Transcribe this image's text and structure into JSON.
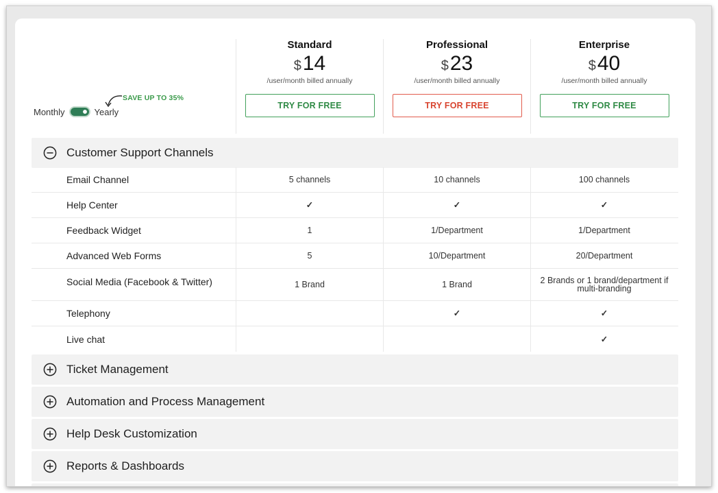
{
  "toggle": {
    "left_label": "Monthly",
    "right_label": "Yearly",
    "note": "SAVE UP TO 35%"
  },
  "plans": [
    {
      "name": "Standard",
      "currency": "$",
      "price": "14",
      "billing": "/user/month billed annually",
      "cta": "TRY FOR FREE",
      "cta_color": "#2f8a45"
    },
    {
      "name": "Professional",
      "currency": "$",
      "price": "23",
      "billing": "/user/month billed annually",
      "cta": "TRY FOR FREE",
      "cta_color": "#d8442f"
    },
    {
      "name": "Enterprise",
      "currency": "$",
      "price": "40",
      "billing": "/user/month billed annually",
      "cta": "TRY FOR FREE",
      "cta_color": "#2f8a45"
    }
  ],
  "sections": [
    {
      "title": "Customer Support Channels",
      "expanded": true,
      "icon": "minus-circle-icon"
    },
    {
      "title": "Ticket Management",
      "expanded": false,
      "icon": "plus-circle-icon"
    },
    {
      "title": "Automation and Process Management",
      "expanded": false,
      "icon": "plus-circle-icon"
    },
    {
      "title": "Help Desk Customization",
      "expanded": false,
      "icon": "plus-circle-icon"
    },
    {
      "title": "Reports & Dashboards",
      "expanded": false,
      "icon": "plus-circle-icon"
    }
  ],
  "features": [
    {
      "name": "Email Channel",
      "values": [
        "5 channels",
        "10 channels",
        "100 channels"
      ]
    },
    {
      "name": "Help Center",
      "values": [
        "✓",
        "✓",
        "✓"
      ]
    },
    {
      "name": "Feedback Widget",
      "values": [
        "1",
        "1/Department",
        "1/Department"
      ]
    },
    {
      "name": "Advanced Web Forms",
      "values": [
        "5",
        "10/Department",
        "20/Department"
      ]
    },
    {
      "name": "Social Media (Facebook & Twitter)",
      "values": [
        "1 Brand",
        "1 Brand",
        "2 Brands or 1 brand/department if multi-branding"
      ]
    },
    {
      "name": "Telephony",
      "values": [
        "",
        "✓",
        "✓"
      ]
    },
    {
      "name": "Live chat",
      "values": [
        "",
        "",
        "✓"
      ]
    }
  ],
  "colors": {
    "accent_green": "#2f7d56",
    "check_green": "#1f5f3c",
    "section_bg": "#f2f2f2"
  }
}
